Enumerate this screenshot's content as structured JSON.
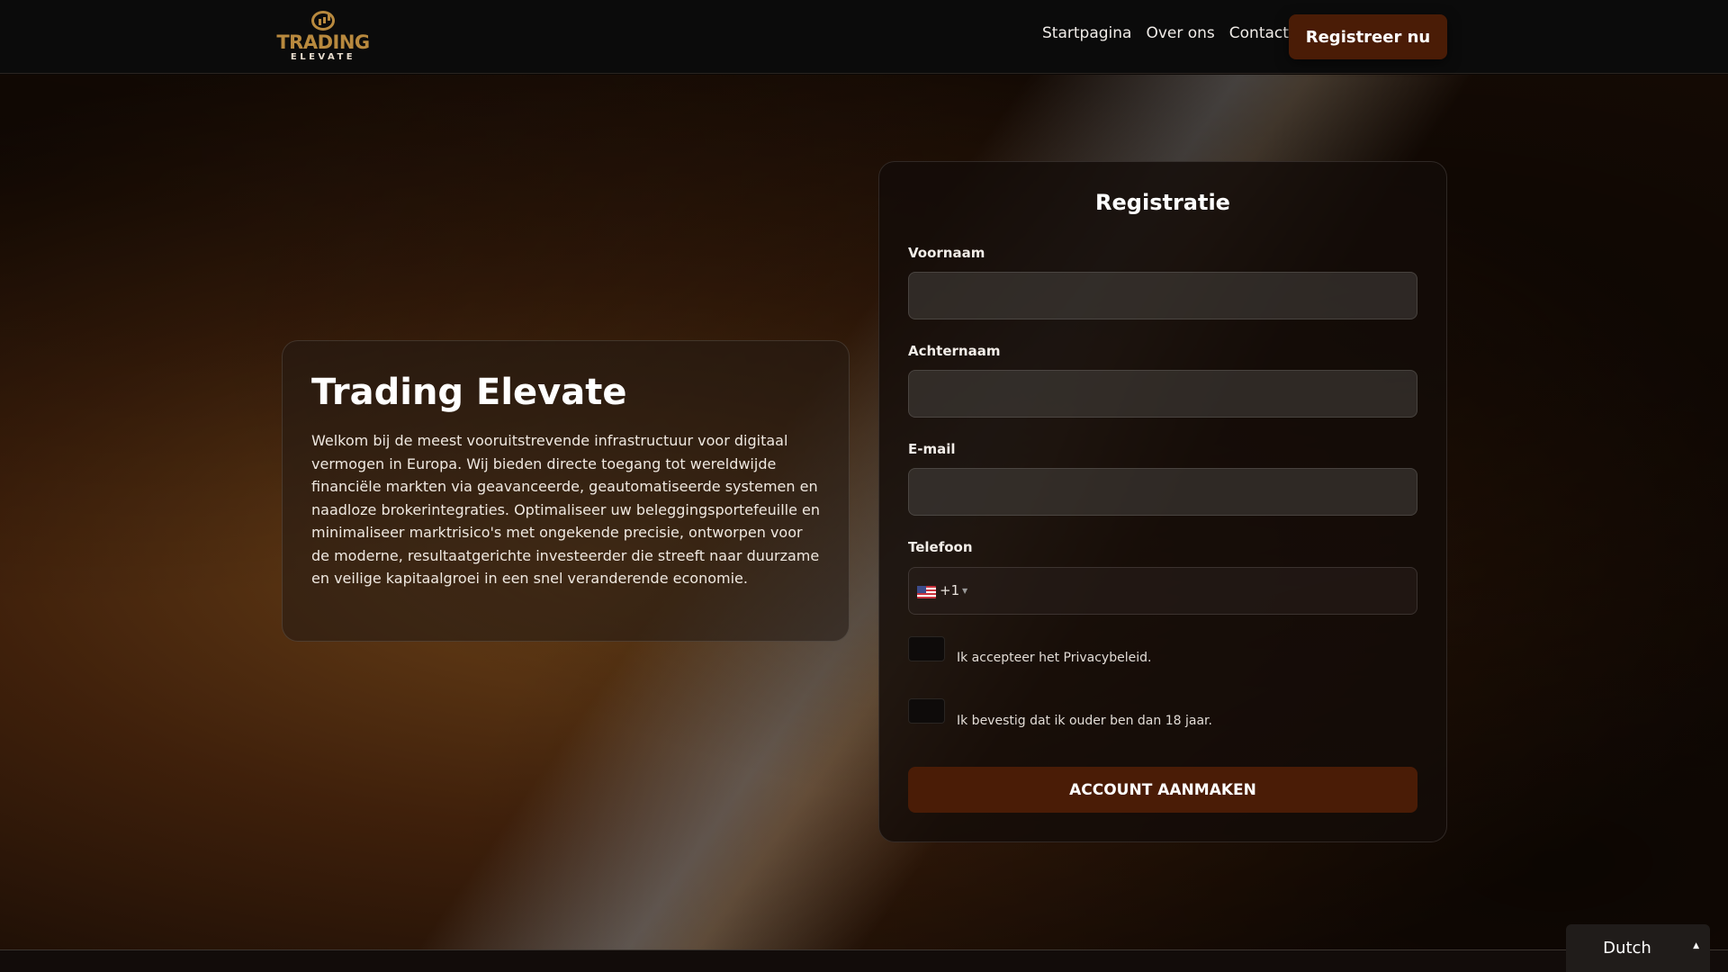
{
  "header": {
    "logo_line1": "TRADING",
    "logo_line2": "ELEVATE",
    "nav": [
      "Startpagina",
      "Over ons",
      "Contact"
    ],
    "cta_label": "Registreer nu"
  },
  "info": {
    "title": "Trading Elevate",
    "text": "Welkom bij de meest vooruitstrevende infrastructuur voor digitaal vermogen in Europa. Wij bieden directe toegang tot wereldwijde financiële markten via geavanceerde, geautomatiseerde systemen en naadloze brokerintegraties. Optimaliseer uw beleggingsportefeuille en minimaliseer marktrisico's met ongekende precisie, ontworpen voor de moderne, resultaatgerichte investeerder die streeft naar duurzame en veilige kapitaalgroei in een snel veranderende economie."
  },
  "form": {
    "title": "Registratie",
    "first_name_label": "Voornaam",
    "first_name_value": "",
    "last_name_label": "Achternaam",
    "last_name_value": "",
    "email_label": "E-mail",
    "email_value": "",
    "phone_label": "Telefoon",
    "phone_dial_code": "+1",
    "phone_flag": "us-flag-icon",
    "phone_value": "",
    "privacy_label": "Ik accepteer het Privacybeleid.",
    "age_label": "Ik bevestig dat ik ouder ben dan 18 jaar.",
    "submit_label": "ACCOUNT AANMAKEN"
  },
  "language": {
    "selected": "Dutch",
    "caret_icon": "caret-up-icon"
  },
  "colors": {
    "accent": "#4a1c06",
    "logo_gold": "#b8893e",
    "header_bg": "#0b0b0b"
  }
}
